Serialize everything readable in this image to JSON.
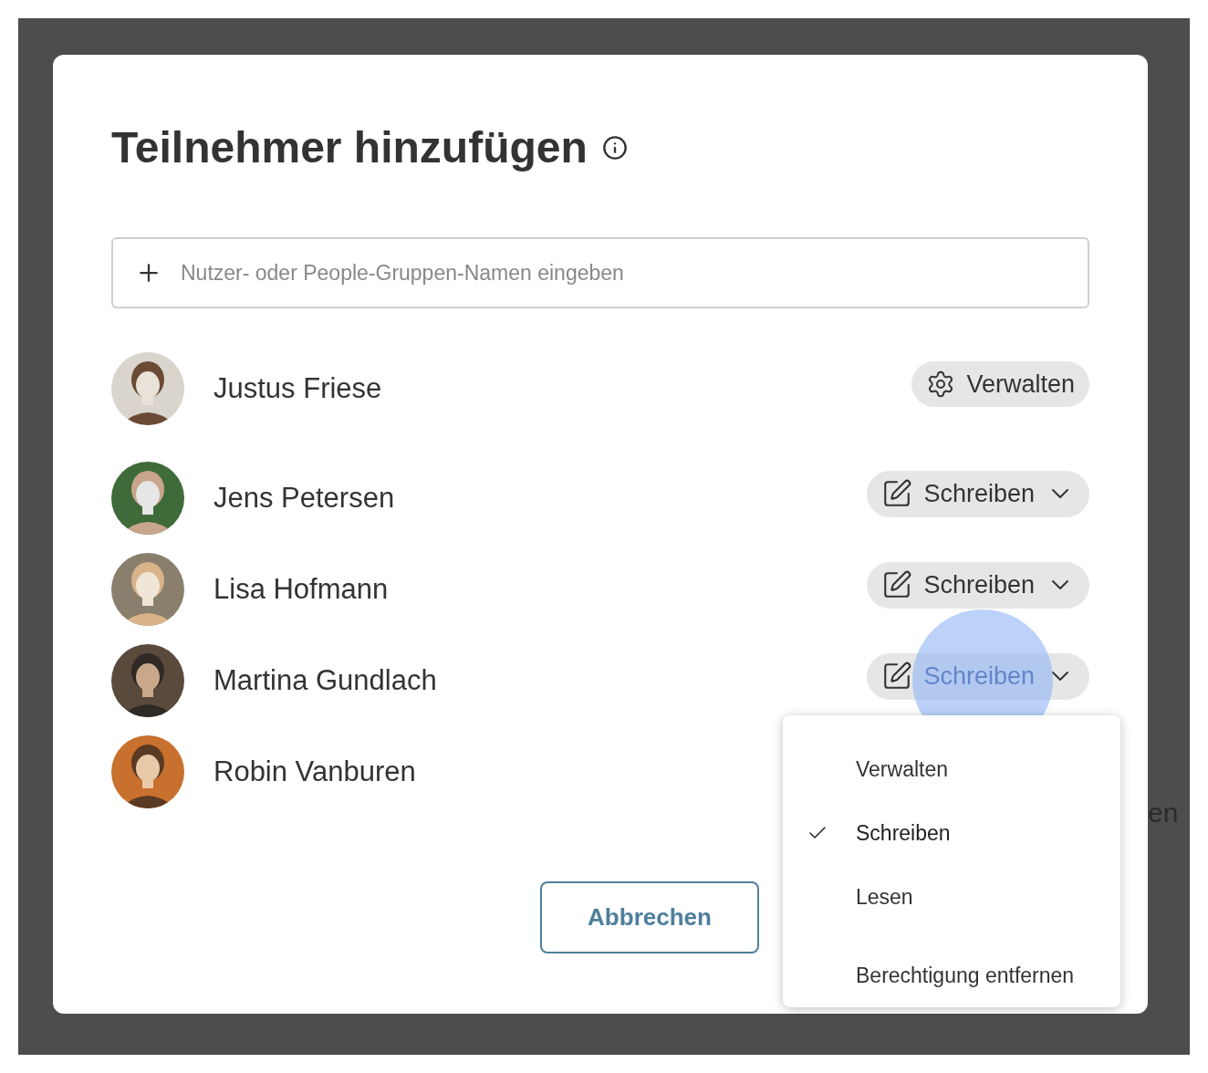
{
  "dialog": {
    "title": "Teilnehmer hinzufügen",
    "search": {
      "placeholder": "Nutzer- oder People-Gruppen-Namen eingeben"
    },
    "participants": [
      {
        "name": "Justus Friese",
        "role": {
          "kind": "manage",
          "label": "Verwalten"
        }
      },
      {
        "name": "Jens Petersen",
        "role": {
          "kind": "dropdown",
          "label": "Schreiben"
        }
      },
      {
        "name": "Lisa Hofmann",
        "role": {
          "kind": "dropdown",
          "label": "Schreiben"
        }
      },
      {
        "name": "Martina Gundlach",
        "role": {
          "kind": "dropdown",
          "label": "Schreiben"
        },
        "expanded": true
      },
      {
        "name": "Robin Vanburen"
      }
    ],
    "role_menu": [
      {
        "label": "Verwalten",
        "selected": false
      },
      {
        "label": "Schreiben",
        "selected": true
      },
      {
        "label": "Lesen",
        "selected": false
      },
      {
        "label": "Berechtigung entfernen",
        "selected": false,
        "kind": "danger"
      }
    ],
    "cancel_button": "Abbrechen"
  },
  "background_text": "en"
}
